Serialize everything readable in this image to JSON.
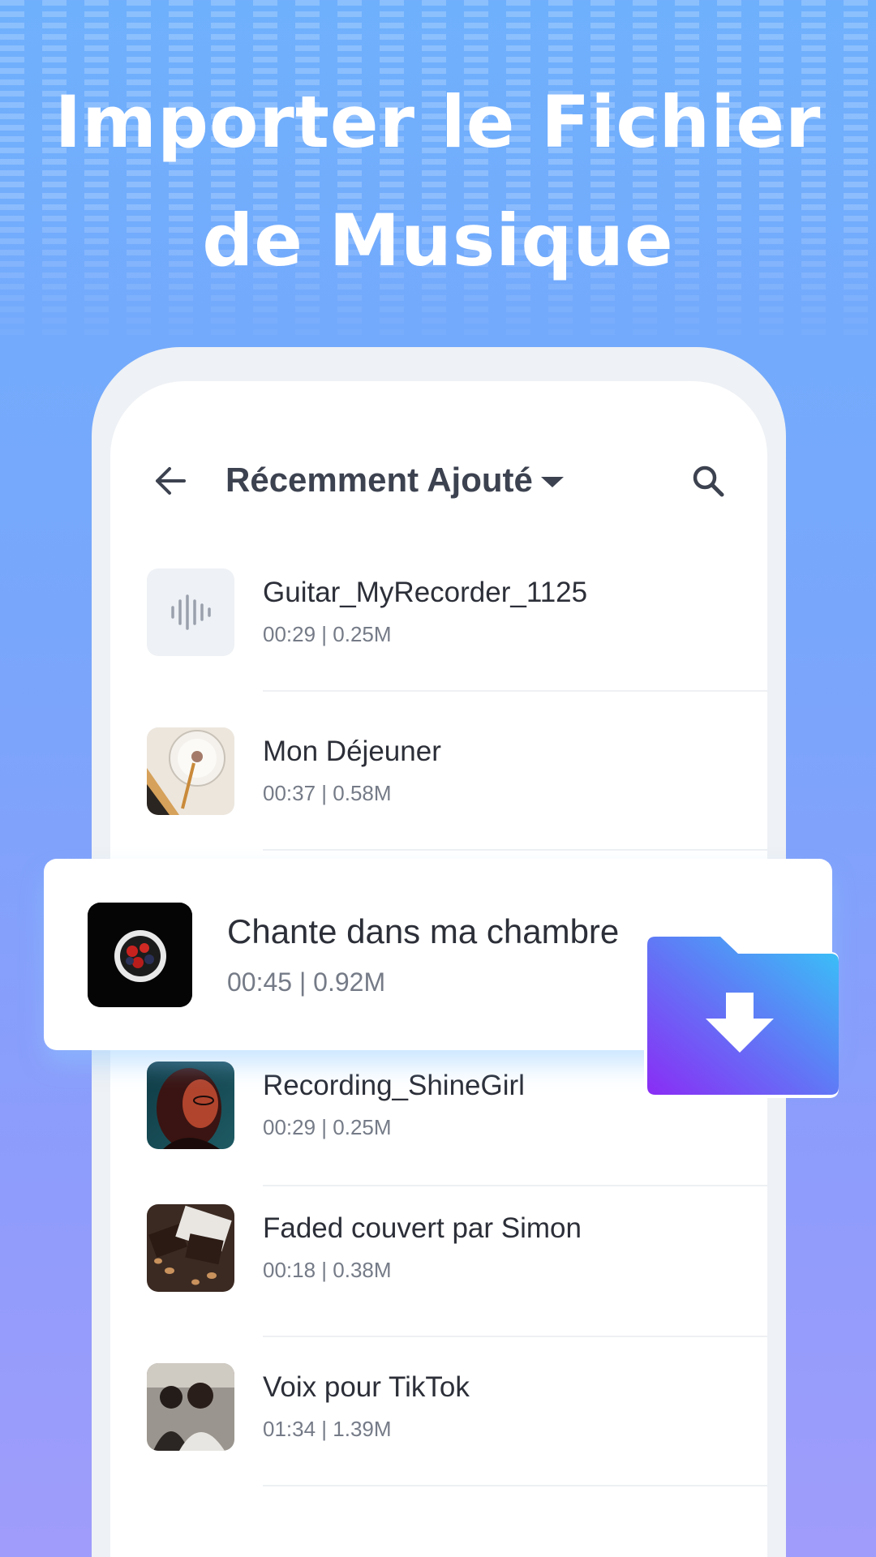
{
  "headline": {
    "line1": "Importer le Fichier",
    "line2": "de Musique"
  },
  "app_bar": {
    "title": "Récemment Ajouté"
  },
  "recordings": [
    {
      "title": "Guitar_MyRecorder_1125",
      "meta": "00:29 | 0.25M",
      "thumb": "waveform-icon"
    },
    {
      "title": "Mon Déjeuner",
      "meta": "00:37 | 0.58M",
      "thumb": "coffee-cup-photo"
    },
    {
      "title": "Recording_ShineGirl",
      "meta": "00:29 | 0.25M",
      "thumb": "girl-portrait-photo"
    },
    {
      "title": "Faded couvert par Simon",
      "meta": "00:18 | 0.38M",
      "thumb": "brownies-photo"
    },
    {
      "title": "Voix pour TikTok",
      "meta": "01:34 | 1.39M",
      "thumb": "couple-photo"
    }
  ],
  "highlight": {
    "title": "Chante dans ma chambre",
    "meta": "00:45 | 0.92M",
    "thumb": "berry-bowl-photo"
  },
  "colors": {
    "accent_start": "#8a2cf5",
    "accent_end": "#36c6f7",
    "text": "#2c2f38",
    "muted": "#757b87"
  }
}
